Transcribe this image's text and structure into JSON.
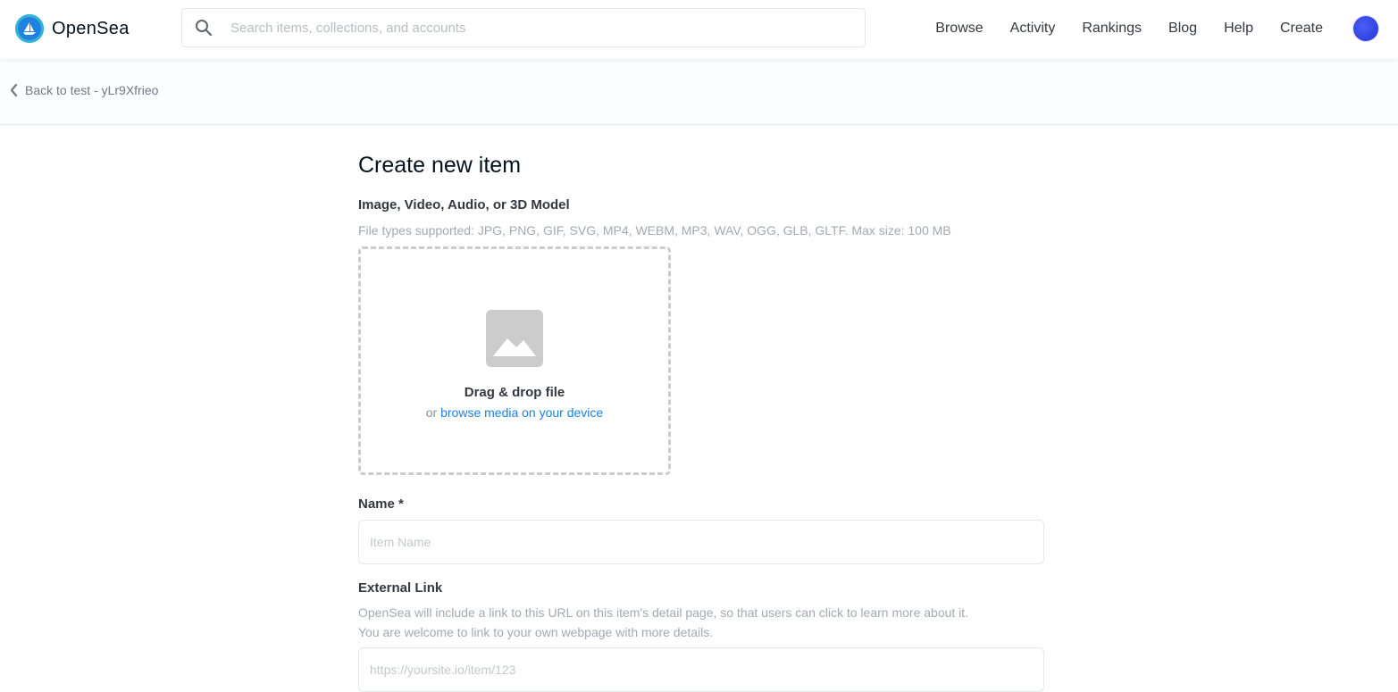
{
  "header": {
    "brand": "OpenSea",
    "search_placeholder": "Search items, collections, and accounts",
    "nav": {
      "browse": "Browse",
      "activity": "Activity",
      "rankings": "Rankings",
      "blog": "Blog",
      "help": "Help",
      "create": "Create"
    },
    "brand_color": "#2081e2"
  },
  "back": {
    "label": "Back to test - yLr9Xfrieo"
  },
  "form": {
    "title": "Create new item",
    "media": {
      "label": "Image, Video, Audio, or 3D Model",
      "hint": "File types supported: JPG, PNG, GIF, SVG, MP4, WEBM, MP3, WAV, OGG, GLB, GLTF. Max size: 100 MB",
      "drop_title": "Drag & drop file",
      "drop_or": "or ",
      "drop_link": "browse media on your device"
    },
    "name": {
      "label": "Name *",
      "placeholder": "Item Name"
    },
    "external_link": {
      "label": "External Link",
      "hint_line1": "OpenSea will include a link to this URL on this item's detail page, so that users can click to learn more about it.",
      "hint_line2": "You are welcome to link to your own webpage with more details.",
      "placeholder": "https://yoursite.io/item/123"
    }
  }
}
